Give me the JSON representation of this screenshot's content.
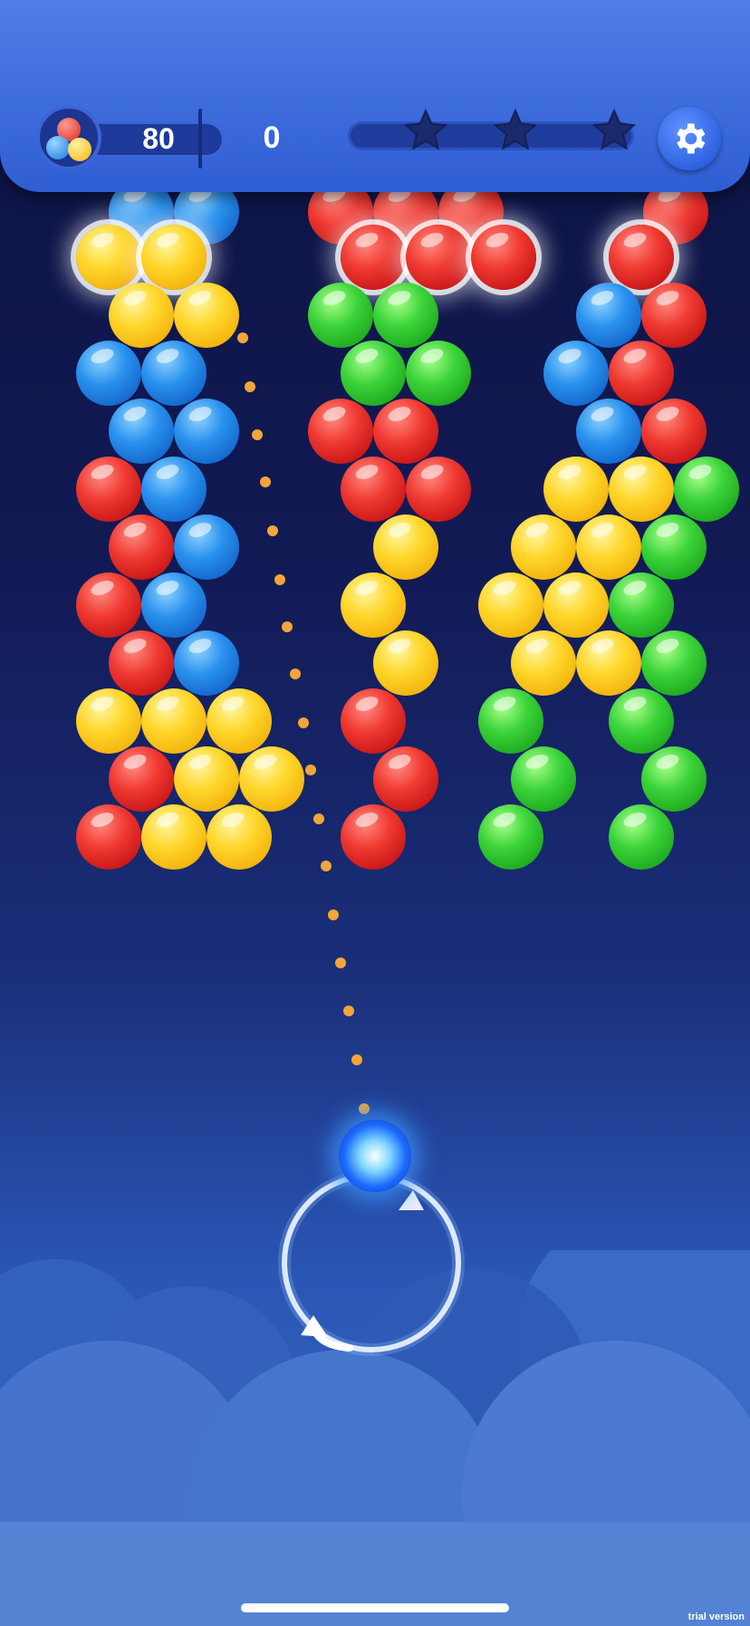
{
  "hud": {
    "bubbles_left": "80",
    "score": "0",
    "stars_total": 3,
    "stars_earned": 0,
    "colors": {
      "accent": "#2f5ed4",
      "star_empty": "#1b2a6b"
    }
  },
  "board": {
    "colors": {
      "red": "#e82a24",
      "blue": "#1f80e0",
      "yellow": "#ffd12a",
      "green": "#2ac42a"
    },
    "bubble_count": 81
  },
  "shooter": {
    "current_color": "blue",
    "power": "lightning"
  },
  "footer": {
    "watermark": "trial version"
  },
  "icons": [
    "bubbles-icon",
    "star-icon",
    "gear-icon",
    "swap-arrows-icon"
  ]
}
